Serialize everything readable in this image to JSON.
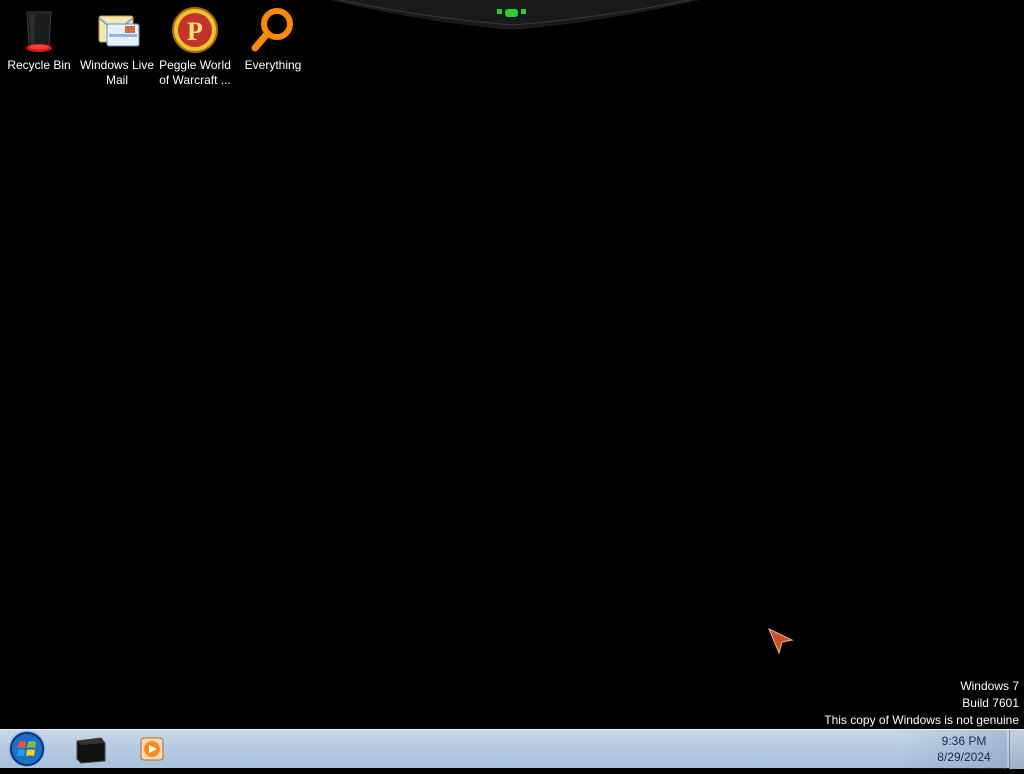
{
  "desktop": {
    "icons": [
      {
        "label": "Recycle Bin",
        "icon": "recycle-bin-icon"
      },
      {
        "label": "Windows Live Mail",
        "icon": "windows-live-mail-icon"
      },
      {
        "label": "Peggle World of Warcraft ...",
        "icon": "peggle-icon"
      },
      {
        "label": "Everything",
        "icon": "everything-search-icon"
      }
    ]
  },
  "watermark": {
    "line1": "Windows 7",
    "line2": "Build 7601",
    "line3": "This copy of Windows is not genuine"
  },
  "taskbar": {
    "start": "windows-start-orb-icon",
    "pinned": [
      "command-prompt-icon",
      "media-player-icon"
    ],
    "clock": {
      "time": "9:36 PM",
      "date": "8/29/2024"
    }
  },
  "colors": {
    "desktop_bg": "#000000",
    "taskbar_top": "#c9d8ea",
    "notch_accent": "#2bd12b"
  }
}
